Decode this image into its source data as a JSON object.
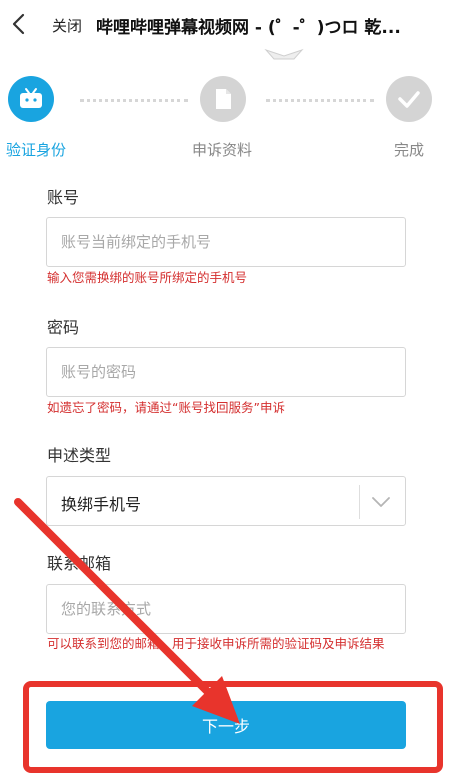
{
  "header": {
    "close_label": "关闭",
    "title": "哔哩哔哩弹幕视频网 - (゜-゜)つロ 乾..."
  },
  "steps": [
    {
      "label": "验证身份",
      "icon": "tv-icon",
      "state": "active"
    },
    {
      "label": "申诉资料",
      "icon": "document-icon",
      "state": "pending"
    },
    {
      "label": "完成",
      "icon": "checkmark-icon",
      "state": "pending"
    }
  ],
  "form": {
    "account": {
      "label": "账号",
      "placeholder": "账号当前绑定的手机号",
      "hint": "输入您需换绑的账号所绑定的手机号"
    },
    "password": {
      "label": "密码",
      "placeholder": "账号的密码",
      "hint": "如遗忘了密码，请通过“账号找回服务”申诉"
    },
    "type": {
      "label": "申述类型",
      "value": "换绑手机号"
    },
    "email": {
      "label": "联系邮箱",
      "placeholder": "您的联系方式",
      "hint": "可以联系到您的邮箱，用于接收申诉所需的验证码及申诉结果"
    }
  },
  "submit": {
    "label": "下一步"
  },
  "colors": {
    "accent": "#19a4e0",
    "hint": "#d42f2f",
    "annotation": "#e8342c"
  }
}
